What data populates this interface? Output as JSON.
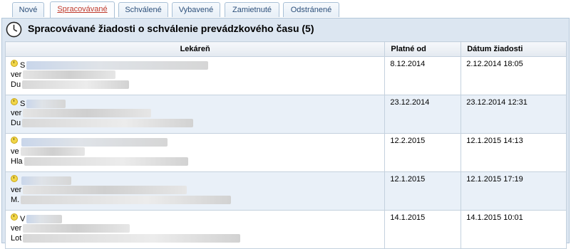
{
  "tabs": [
    {
      "label": "Nové"
    },
    {
      "label": "Spracovávané"
    },
    {
      "label": "Schválené"
    },
    {
      "label": "Vybavené"
    },
    {
      "label": "Zamietnuté"
    },
    {
      "label": "Odstránené"
    }
  ],
  "active_tab": "Spracovávané",
  "title": "Spracovávané žiadosti o schválenie prevádzkového času (5)",
  "columns": [
    "Lekáreň",
    "Platné od",
    "Dátum žiadosti"
  ],
  "rows": [
    {
      "pharmacy_line1": "S",
      "pharmacy_line2": "ver",
      "pharmacy_line3": "Du",
      "valid_from": "8.12.2014",
      "request_date": "2.12.2014 18:05"
    },
    {
      "pharmacy_line1": "S",
      "pharmacy_line2": "ver",
      "pharmacy_line3": "Du",
      "valid_from": "23.12.2014",
      "request_date": "23.12.2014 12:31"
    },
    {
      "pharmacy_line1": "",
      "pharmacy_line2": "ve",
      "pharmacy_line3": "Hla",
      "valid_from": "12.2.2015",
      "request_date": "12.1.2015 14:13"
    },
    {
      "pharmacy_line1": "",
      "pharmacy_line2": "ver",
      "pharmacy_line3": "M.",
      "valid_from": "12.1.2015",
      "request_date": "12.1.2015 17:19"
    },
    {
      "pharmacy_line1": "V",
      "pharmacy_line2": "ver",
      "pharmacy_line3": "Lot",
      "valid_from": "14.1.2015",
      "request_date": "14.1.2015 10:01"
    }
  ],
  "colors": {
    "panel_bg": "#dce6f1",
    "row_alt": "#e9f0f8",
    "active_tab_text": "#c0392b",
    "tab_text": "#2c4f7a"
  },
  "icons": {
    "header": "clock-icon",
    "row": "status-clock-icon"
  }
}
